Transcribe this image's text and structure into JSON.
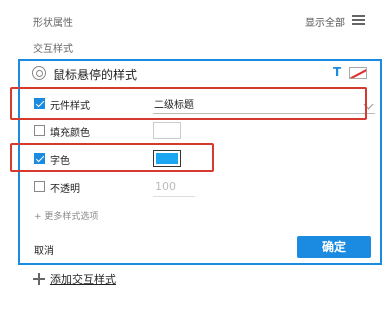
{
  "header": {
    "section_title": "形状属性",
    "show_all_label": "显示全部",
    "menu_icon": "hamburger-menu-icon",
    "interaction_label": "交互样式"
  },
  "panel": {
    "title": "鼠标悬停的样式",
    "title_icon": "target-icon",
    "text_style_icon": "T",
    "fill_style_icon": "no-fill-swatch-icon",
    "rows": {
      "widget_style": {
        "label": "元件样式",
        "checked": true,
        "value": "二级标题"
      },
      "fill_color": {
        "label": "填充颜色",
        "checked": false,
        "color": "#ffffff"
      },
      "font_color": {
        "label": "字色",
        "checked": true,
        "color": "#1aa6f0"
      },
      "opacity": {
        "label": "不透明",
        "checked": false,
        "value": "100"
      }
    },
    "more_options": "+ 更多样式选项",
    "cancel_label": "取消",
    "confirm_label": "确定"
  },
  "footer": {
    "add_label": "添加交互样式"
  },
  "colors": {
    "accent": "#1a8be0",
    "highlight": "#d63a2f"
  }
}
